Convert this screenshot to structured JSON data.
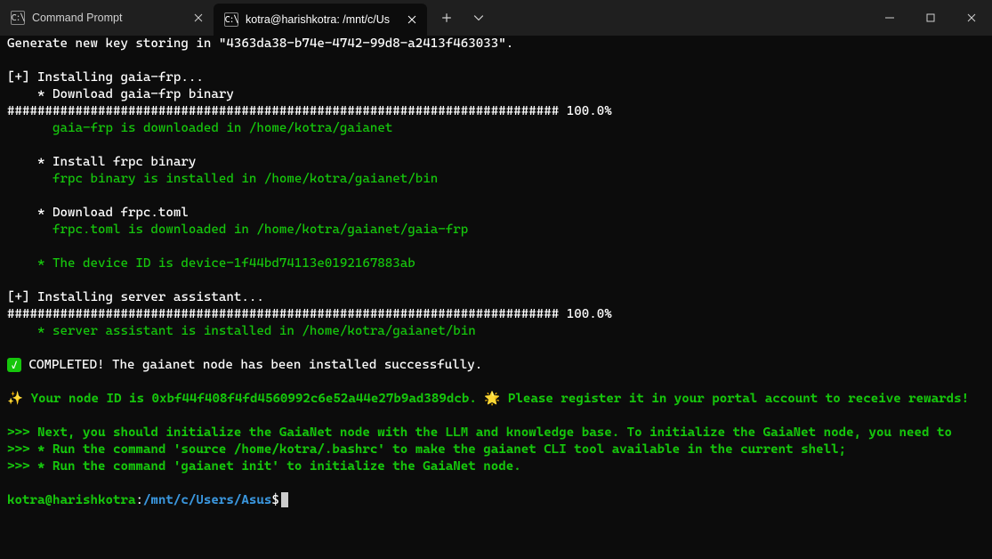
{
  "tabs": [
    {
      "title": "Command Prompt",
      "icon": "cmd-icon"
    },
    {
      "title": "kotra@harishkotra: /mnt/c/Us",
      "icon": "wsl-icon"
    }
  ],
  "term": {
    "line_keygen": "Generate new key storing in \"4363da38-b74e-4742-99d8-a2413f463033\".",
    "inst_frp": "[+] Installing gaia-frp...",
    "dl_frp_bin": "    * Download gaia-frp binary",
    "bar1": "######################################################################### 100.0%",
    "frp_dl_msg": "      gaia-frp is downloaded in /home/kotra/gaianet",
    "inst_frpc": "    * Install frpc binary",
    "frpc_msg": "      frpc binary is installed in /home/kotra/gaianet/bin",
    "dl_toml": "    * Download frpc.toml",
    "toml_msg": "      frpc.toml is downloaded in /home/kotra/gaianet/gaia-frp",
    "device_id": "    * The device ID is device-1f44bd74113e0192167883ab",
    "inst_srv": "[+] Installing server assistant...",
    "bar2": "######################################################################### 100.0%",
    "srv_msg": "    * server assistant is installed in /home/kotra/gaianet/bin",
    "completed": " COMPLETED! The gaianet node has been installed successfully.",
    "sparkle": "✨ ",
    "node_id_line": "Your node ID is 0xbf44f408f4fd4560992c6e52a44e27b9ad389dcb. ",
    "sun": "🌟 ",
    "register_line": "Please register it in your portal account to receive rewards!",
    "next1": ">>> Next, you should initialize the GaiaNet node with the LLM and knowledge base. To initialize the GaiaNet node, you need to",
    "next2": ">>> * Run the command 'source /home/kotra/.bashrc' to make the gaianet CLI tool available in the current shell;",
    "next3": ">>> * Run the command 'gaianet init' to initialize the GaiaNet node.",
    "prompt_user": "kotra@harishkotra",
    "prompt_colon": ":",
    "prompt_path": "/mnt/c/Users/Asus",
    "prompt_dollar": "$"
  }
}
